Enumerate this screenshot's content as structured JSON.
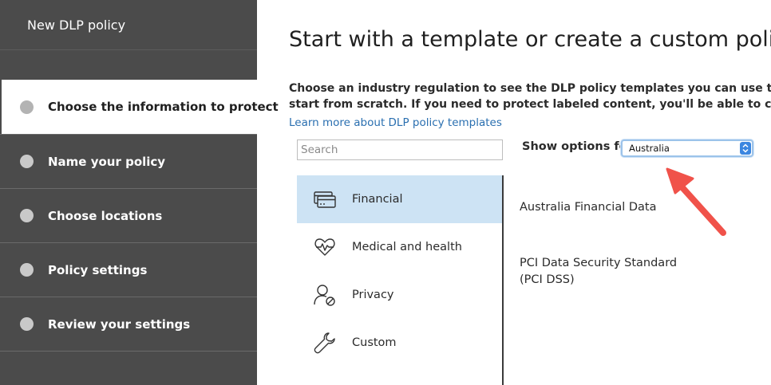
{
  "sidebar": {
    "title": "New DLP policy",
    "steps": [
      {
        "label": "Choose the information to protect",
        "active": true
      },
      {
        "label": "Name your policy",
        "active": false
      },
      {
        "label": "Choose locations",
        "active": false
      },
      {
        "label": "Policy settings",
        "active": false
      },
      {
        "label": "Review your settings",
        "active": false
      }
    ]
  },
  "main": {
    "title": "Start with a template or create a custom policy",
    "description_line1": "Choose an industry regulation to see the DLP policy templates you can use to protect that info or",
    "description_line2": "start from scratch. If you need to protect labeled content, you'll be able to choose labels later.",
    "learn_more_link": "Learn more about DLP policy templates",
    "search": {
      "placeholder": "Search",
      "value": ""
    },
    "show_options": {
      "label": "Show options for",
      "selected": "Australia"
    },
    "categories": [
      {
        "label": "Financial",
        "icon": "credit-card-icon",
        "selected": true
      },
      {
        "label": "Medical and health",
        "icon": "heart-pulse-icon",
        "selected": false
      },
      {
        "label": "Privacy",
        "icon": "person-block-icon",
        "selected": false
      },
      {
        "label": "Custom",
        "icon": "wrench-icon",
        "selected": false
      }
    ],
    "templates": [
      {
        "label": "Australia Financial Data"
      },
      {
        "label": "PCI Data Security Standard (PCI DSS)"
      }
    ]
  },
  "colors": {
    "sidebar_bg": "#4b4b4b",
    "selected_bg": "#cde3f4",
    "link": "#2a6fb0",
    "annotation_arrow": "#f0524a"
  }
}
